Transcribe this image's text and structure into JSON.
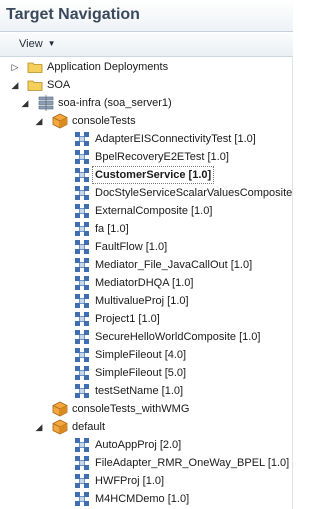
{
  "header": {
    "title": "Target Navigation"
  },
  "toolbar": {
    "view_label": "View"
  },
  "tree": {
    "application_deployments": "Application Deployments",
    "soa": "SOA",
    "soa_infra": "soa-infra (soa_server1)",
    "console_tests": "consoleTests",
    "composites": [
      "AdapterEISConnectivityTest [1.0]",
      "BpelRecoveryE2ETest [1.0]",
      "CustomerService [1.0]",
      "DocStyleServiceScalarValuesComposite [",
      "ExternalComposite [1.0]",
      "fa [1.0]",
      "FaultFlow [1.0]",
      "Mediator_File_JavaCallOut [1.0]",
      "MediatorDHQA [1.0]",
      "MultivalueProj [1.0]",
      "Project1 [1.0]",
      "SecureHelloWorldComposite [1.0]",
      "SimpleFileout [4.0]",
      "SimpleFileout [5.0]",
      "testSetName [1.0]"
    ],
    "console_tests_wmg": "consoleTests_withWMG",
    "default": "default",
    "default_composites": [
      "AutoAppProj [2.0]",
      "FileAdapter_RMR_OneWay_BPEL [1.0]",
      "HWFProj [1.0]",
      "M4HCMDemo [1.0]"
    ],
    "selected": "CustomerService [1.0]"
  },
  "icons": {
    "folder": "folder-icon",
    "server": "server-icon",
    "partition": "partition-icon",
    "composite": "composite-icon",
    "expanded": "expanded-icon",
    "collapsed": "collapsed-icon"
  }
}
